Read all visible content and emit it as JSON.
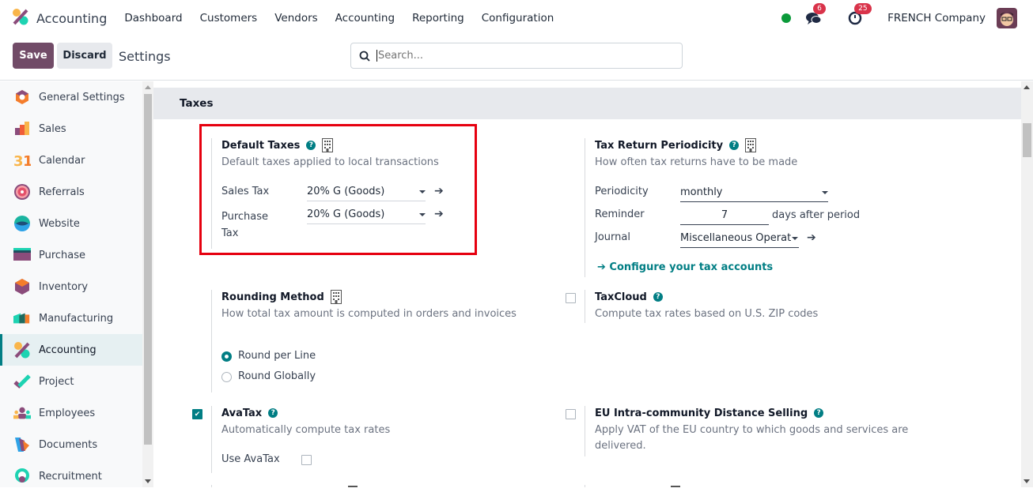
{
  "topbar": {
    "app_name": "Accounting",
    "nav": [
      "Dashboard",
      "Customers",
      "Vendors",
      "Accounting",
      "Reporting",
      "Configuration"
    ],
    "messages_count": "6",
    "activities_count": "25",
    "company": "FRENCH Company"
  },
  "controls": {
    "save_label": "Save",
    "discard_label": "Discard",
    "breadcrumb": "Settings",
    "search_placeholder": "Search..."
  },
  "sidebar": {
    "items": [
      {
        "label": "General Settings",
        "icon": "general-settings-icon"
      },
      {
        "label": "Sales",
        "icon": "sales-icon"
      },
      {
        "label": "Calendar",
        "icon": "calendar-icon"
      },
      {
        "label": "Referrals",
        "icon": "referrals-icon"
      },
      {
        "label": "Website",
        "icon": "website-icon"
      },
      {
        "label": "Purchase",
        "icon": "purchase-icon"
      },
      {
        "label": "Inventory",
        "icon": "inventory-icon"
      },
      {
        "label": "Manufacturing",
        "icon": "manufacturing-icon"
      },
      {
        "label": "Accounting",
        "icon": "accounting-icon",
        "active": true
      },
      {
        "label": "Project",
        "icon": "project-icon"
      },
      {
        "label": "Employees",
        "icon": "employees-icon"
      },
      {
        "label": "Documents",
        "icon": "documents-icon"
      },
      {
        "label": "Recruitment",
        "icon": "recruitment-icon"
      }
    ]
  },
  "section": {
    "title": "Taxes",
    "default_taxes": {
      "title": "Default Taxes",
      "desc": "Default taxes applied to local transactions",
      "sales_tax_label": "Sales Tax",
      "sales_tax_value": "20% G (Goods)",
      "purchase_tax_label_1": "Purchase",
      "purchase_tax_label_2": "Tax",
      "purchase_tax_value": "20% G (Goods)"
    },
    "tax_return": {
      "title": "Tax Return Periodicity",
      "desc": "How often tax returns have to be made",
      "periodicity_label": "Periodicity",
      "periodicity_value": "monthly",
      "reminder_label": "Reminder",
      "reminder_value": "7",
      "reminder_suffix": "days after period",
      "journal_label": "Journal",
      "journal_value": "Miscellaneous Operat",
      "configure_link": "Configure your tax accounts"
    },
    "rounding": {
      "title": "Rounding Method",
      "desc": "How total tax amount is computed in orders and invoices",
      "options": [
        "Round per Line",
        "Round Globally"
      ],
      "selected": "Round per Line"
    },
    "taxcloud": {
      "title": "TaxCloud",
      "desc": "Compute tax rates based on U.S. ZIP codes",
      "checked": false
    },
    "avatax": {
      "title": "AvaTax",
      "desc": "Automatically compute tax rates",
      "checked": true,
      "use_label": "Use AvaTax",
      "use_checked": false
    },
    "eu_distance": {
      "title": "EU Intra-community Distance Selling",
      "desc_1": "Apply VAT of the EU country to which goods and services are",
      "desc_2": "delivered.",
      "checked": false
    }
  }
}
